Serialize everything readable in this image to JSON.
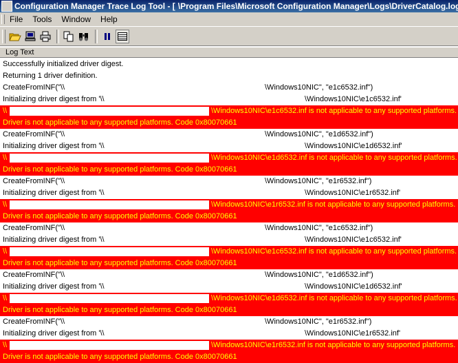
{
  "title": {
    "prefix": "Configuration Manager Trace Log Tool - [",
    "suffix": "\\Program Files\\Microsoft Configuration Manager\\Logs\\DriverCatalog.log]"
  },
  "menu": [
    "File",
    "Tools",
    "Window",
    "Help"
  ],
  "toolbar": {
    "icons": [
      "open-folder-icon",
      "computer-icon",
      "print-icon",
      "copy-icon",
      "find-icon",
      "pause-icon",
      "log-view-icon"
    ]
  },
  "column_header": "Log Text",
  "rows": [
    {
      "type": "info",
      "a": "Successfully initialized driver digest."
    },
    {
      "type": "info",
      "a": "Returning 1 driver definition."
    },
    {
      "type": "info",
      "a": "CreateFromINF(\"\\\\",
      "b": "\\Windows10NIC\", \"e1c6532.inf\")"
    },
    {
      "type": "info",
      "a": "Initializing driver digest from '\\\\",
      "c": "\\Windows10NIC\\e1c6532.inf'"
    },
    {
      "type": "err",
      "a": "\\\\",
      "d": "\\Windows10NIC\\e1c6532.inf is not applicable to any supported platforms."
    },
    {
      "type": "err",
      "a": "Driver is not applicable to any supported platforms. Code 0x80070661"
    },
    {
      "type": "info",
      "a": "CreateFromINF(\"\\\\",
      "b": "\\Windows10NIC\", \"e1d6532.inf\")"
    },
    {
      "type": "info",
      "a": "Initializing driver digest from '\\\\",
      "c": "\\Windows10NIC\\e1d6532.inf'"
    },
    {
      "type": "err",
      "a": "\\\\",
      "d": "\\Windows10NIC\\e1d6532.inf is not applicable to any supported platforms."
    },
    {
      "type": "err",
      "a": "Driver is not applicable to any supported platforms. Code 0x80070661"
    },
    {
      "type": "info",
      "a": "CreateFromINF(\"\\\\",
      "b": "\\Windows10NIC\", \"e1r6532.inf\")"
    },
    {
      "type": "info",
      "a": "Initializing driver digest from '\\\\",
      "c": "\\Windows10NIC\\e1r6532.inf'"
    },
    {
      "type": "err",
      "a": "\\\\",
      "d": "\\Windows10NIC\\e1r6532.inf is not applicable to any supported platforms."
    },
    {
      "type": "err",
      "a": "Driver is not applicable to any supported platforms. Code 0x80070661"
    },
    {
      "type": "info",
      "a": "CreateFromINF(\"\\\\",
      "b": "\\Windows10NIC\", \"e1c6532.inf\")"
    },
    {
      "type": "info",
      "a": "Initializing driver digest from '\\\\",
      "c": "\\Windows10NIC\\e1c6532.inf'"
    },
    {
      "type": "err",
      "a": "\\\\",
      "d": "\\Windows10NIC\\e1c6532.inf is not applicable to any supported platforms."
    },
    {
      "type": "err",
      "a": "Driver is not applicable to any supported platforms. Code 0x80070661"
    },
    {
      "type": "info",
      "a": "CreateFromINF(\"\\\\",
      "b": "\\Windows10NIC\", \"e1d6532.inf\")"
    },
    {
      "type": "info",
      "a": "Initializing driver digest from '\\\\",
      "c": "\\Windows10NIC\\e1d6532.inf'"
    },
    {
      "type": "err",
      "a": "\\\\",
      "d": "\\Windows10NIC\\e1d6532.inf is not applicable to any supported platforms."
    },
    {
      "type": "err",
      "a": "Driver is not applicable to any supported platforms. Code 0x80070661"
    },
    {
      "type": "info",
      "a": "CreateFromINF(\"\\\\",
      "b": "\\Windows10NIC\", \"e1r6532.inf\")"
    },
    {
      "type": "info",
      "a": "Initializing driver digest from '\\\\",
      "c": "\\Windows10NIC\\e1r6532.inf'"
    },
    {
      "type": "err",
      "a": "\\\\",
      "d": "\\Windows10NIC\\e1r6532.inf is not applicable to any supported platforms."
    },
    {
      "type": "err",
      "a": "Driver is not applicable to any supported platforms. Code 0x80070661"
    }
  ],
  "colors": {
    "error_bg": "#ff0000",
    "error_text": "#ffff00",
    "title_bg": "#0a246a"
  }
}
